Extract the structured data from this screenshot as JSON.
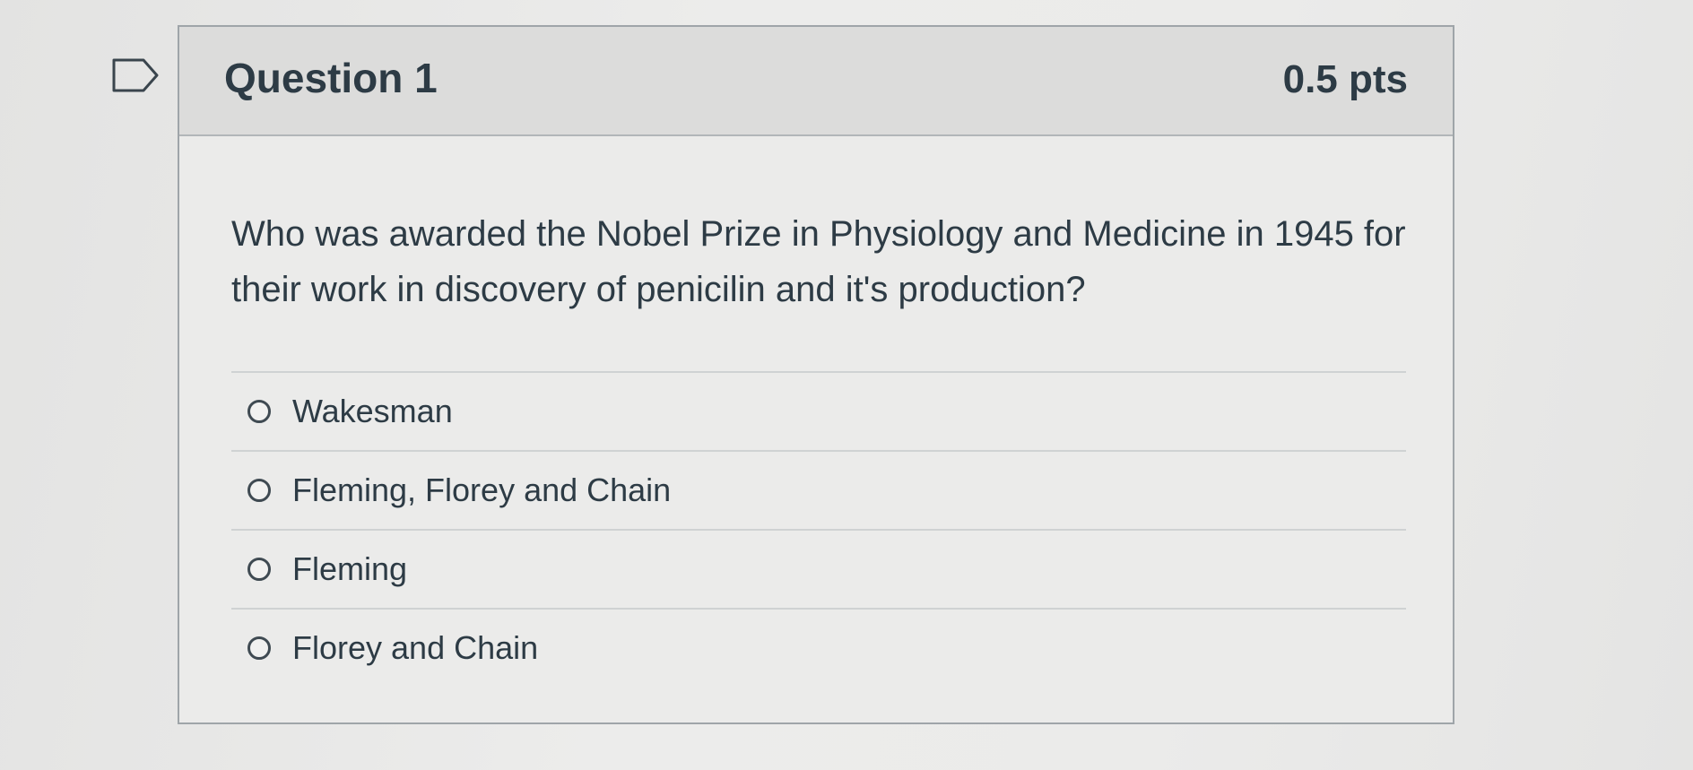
{
  "question": {
    "title": "Question 1",
    "points": "0.5 pts",
    "text": "Who was awarded the Nobel Prize in Physiology and Medicine in 1945 for their work in discovery of penicilin and it's production?",
    "answers": [
      {
        "label": "Wakesman",
        "selected": false
      },
      {
        "label": "Fleming, Florey and Chain",
        "selected": false
      },
      {
        "label": "Fleming",
        "selected": false
      },
      {
        "label": "Florey and Chain",
        "selected": false
      }
    ]
  },
  "icons": {
    "flag": "flag-outline-icon"
  },
  "colors": {
    "text": "#2d3b45",
    "header_bg": "#dcdcdb",
    "border": "#9fa5a9"
  }
}
